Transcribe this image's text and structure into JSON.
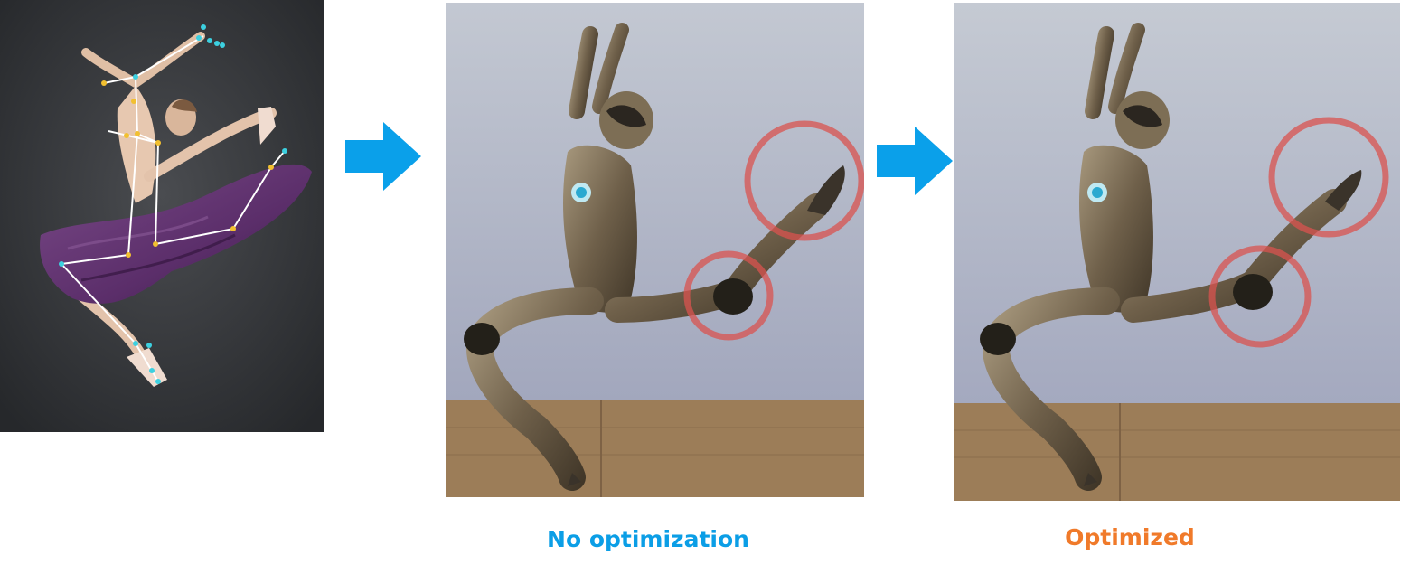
{
  "captions": {
    "no_optimization": "No optimization",
    "optimized": "Optimized"
  },
  "colors": {
    "arrow": "#0aa0ea",
    "caption_no_optimization": "#0b9ee6",
    "caption_optimized": "#f07a2a",
    "highlight_circle": "#d9534f",
    "photo_background": "#34363a",
    "skeleton_line": "#ffffff",
    "skeleton_joint": "#f2c030",
    "hand_foot_keypoints": "#3cd0e0",
    "dress": "#5b2e6a",
    "sky": "#b7bccb",
    "floor": "#9c7d58",
    "robot_metal": "#7a6a52"
  },
  "icons": {
    "arrow_1": "arrow-right-icon",
    "arrow_2": "arrow-right-icon"
  }
}
